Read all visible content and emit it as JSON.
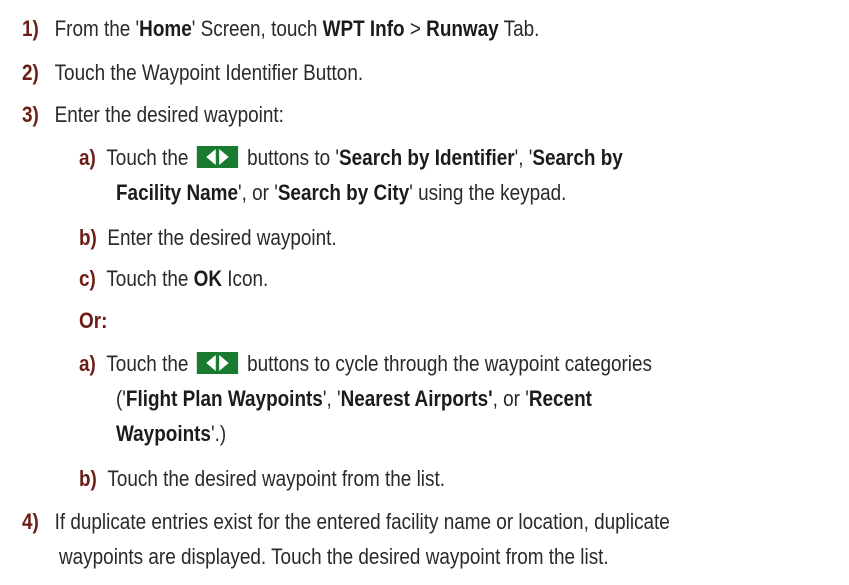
{
  "steps": {
    "s1": {
      "num": "1)",
      "pre": "From the '",
      "home": "Home",
      "mid": "' Screen, touch ",
      "wpt": "WPT Info",
      "gt": " > ",
      "runway": "Runway",
      "post": " Tab."
    },
    "s2": {
      "num": "2)",
      "text": "Touch the Waypoint Identifier Button."
    },
    "s3": {
      "num": "3)",
      "text": "Enter the desired waypoint:"
    },
    "s3a": {
      "num": "a)",
      "pre": "Touch the ",
      "mid": " buttons to '",
      "b1": "Search by Identifier",
      "sep1": "', '",
      "b2": "Search by"
    },
    "s3a_cont": {
      "b2": "Facility Name",
      "sep2": "', or '",
      "b3": "Search by City",
      "post": "' using the keypad."
    },
    "s3b": {
      "num": "b)",
      "text": "Enter the desired waypoint."
    },
    "s3c": {
      "num": "c)",
      "pre": "Touch the ",
      "ok": "OK",
      "post": " Icon."
    },
    "or": "Or:",
    "s3a2": {
      "num": "a)",
      "pre": "Touch the ",
      "post": " buttons to cycle through the waypoint categories"
    },
    "s3a2_cont": {
      "open": "('",
      "b1": "Flight Plan Waypoints",
      "sep1": "', '",
      "b2": "Nearest Airports'",
      "sep2": ", or '",
      "b3": "Recent"
    },
    "s3a2_cont2": {
      "b3": "Waypoints",
      "post": "'.)"
    },
    "s3b2": {
      "num": "b)",
      "text": "Touch the desired waypoint from the list."
    },
    "s4": {
      "num": "4)",
      "line1": "If duplicate entries exist for the entered facility name or location, duplicate",
      "line2": "waypoints are displayed.  Touch the desired waypoint from the list."
    }
  },
  "icons": {
    "arrows": "left-right-arrow-buttons-icon"
  },
  "colors": {
    "number": "#6b1d16",
    "arrow_button": "#197a30"
  }
}
